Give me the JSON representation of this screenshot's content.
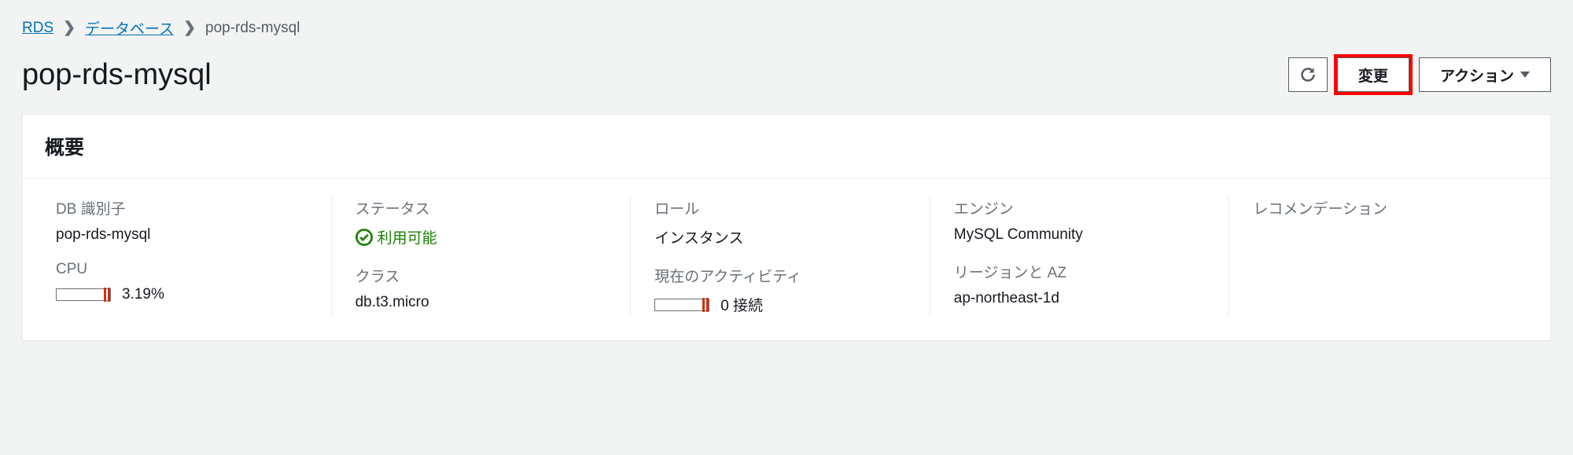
{
  "breadcrumb": {
    "root": "RDS",
    "level1": "データベース",
    "current": "pop-rds-mysql"
  },
  "header": {
    "title": "pop-rds-mysql",
    "buttons": {
      "modify": "変更",
      "actions": "アクション"
    }
  },
  "summary": {
    "title": "概要",
    "cols": [
      {
        "items": [
          {
            "label": "DB 識別子",
            "value": "pop-rds-mysql"
          },
          {
            "label": "CPU",
            "value": "3.19%"
          }
        ]
      },
      {
        "items": [
          {
            "label": "ステータス",
            "value": "利用可能",
            "status": "ok"
          },
          {
            "label": "クラス",
            "value": "db.t3.micro"
          }
        ]
      },
      {
        "items": [
          {
            "label": "ロール",
            "value": "インスタンス"
          },
          {
            "label": "現在のアクティビティ",
            "value": "0 接続"
          }
        ]
      },
      {
        "items": [
          {
            "label": "エンジン",
            "value": "MySQL Community"
          },
          {
            "label": "リージョンと AZ",
            "value": "ap-northeast-1d"
          }
        ]
      },
      {
        "items": [
          {
            "label": "レコメンデーション",
            "value": ""
          }
        ]
      }
    ]
  }
}
